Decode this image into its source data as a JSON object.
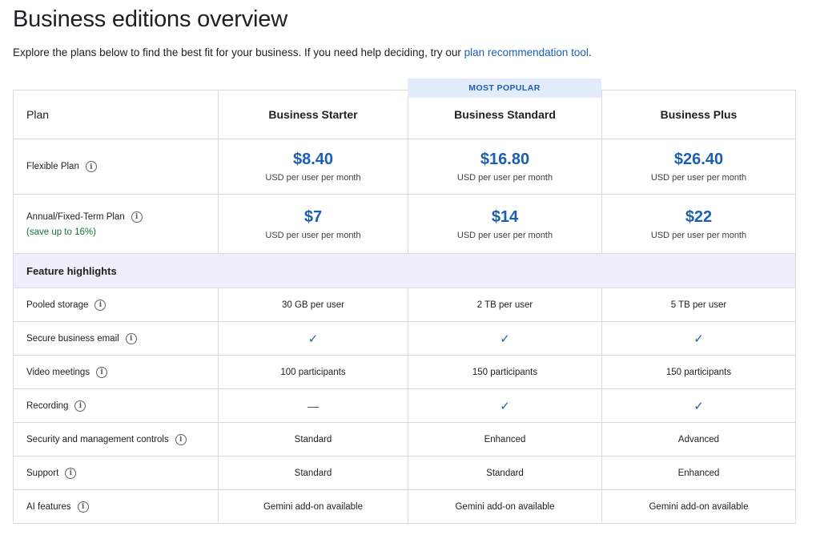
{
  "page": {
    "title": "Business editions overview",
    "intro_text": "Explore the plans below to find the best fit for your business. If you need help deciding, try our ",
    "intro_link": "plan recommendation tool",
    "intro_end": "."
  },
  "badge": {
    "label": "MOST POPULAR"
  },
  "table": {
    "plan_header": "Plan",
    "plans": [
      "Business Starter",
      "Business Standard",
      "Business Plus"
    ],
    "flexible": {
      "label": "Flexible Plan",
      "prices": [
        "$8.40",
        "$16.80",
        "$26.40"
      ],
      "unit": "USD per user per month"
    },
    "annual": {
      "label": "Annual/Fixed-Term Plan",
      "savings": "(save up to 16%)",
      "prices": [
        "$7",
        "$14",
        "$22"
      ],
      "unit": "USD per user per month"
    },
    "section_label": "Feature highlights",
    "features": [
      {
        "label": "Pooled storage",
        "values": [
          "30 GB per user",
          "2 TB per user",
          "5 TB per user"
        ]
      },
      {
        "label": "Secure business email",
        "values": [
          "✓",
          "✓",
          "✓"
        ]
      },
      {
        "label": "Video meetings",
        "values": [
          "100 participants",
          "150 participants",
          "150 participants"
        ]
      },
      {
        "label": "Recording",
        "values": [
          "—",
          "✓",
          "✓"
        ]
      },
      {
        "label": "Security and management controls",
        "values": [
          "Standard",
          "Enhanced",
          "Advanced"
        ]
      },
      {
        "label": "Support",
        "values": [
          "Standard",
          "Standard",
          "Enhanced"
        ]
      },
      {
        "label": "AI features",
        "values": [
          "Gemini add-on available",
          "Gemini add-on available",
          "Gemini add-on available"
        ]
      }
    ]
  },
  "icons": {
    "info": "info-icon",
    "check": "checkmark-icon",
    "dash": "dash-icon"
  },
  "colors": {
    "accent": "#1a5fb4",
    "savings": "#137333",
    "section_bg": "#f0eefa",
    "badge_bg": "#e3ecfb"
  }
}
